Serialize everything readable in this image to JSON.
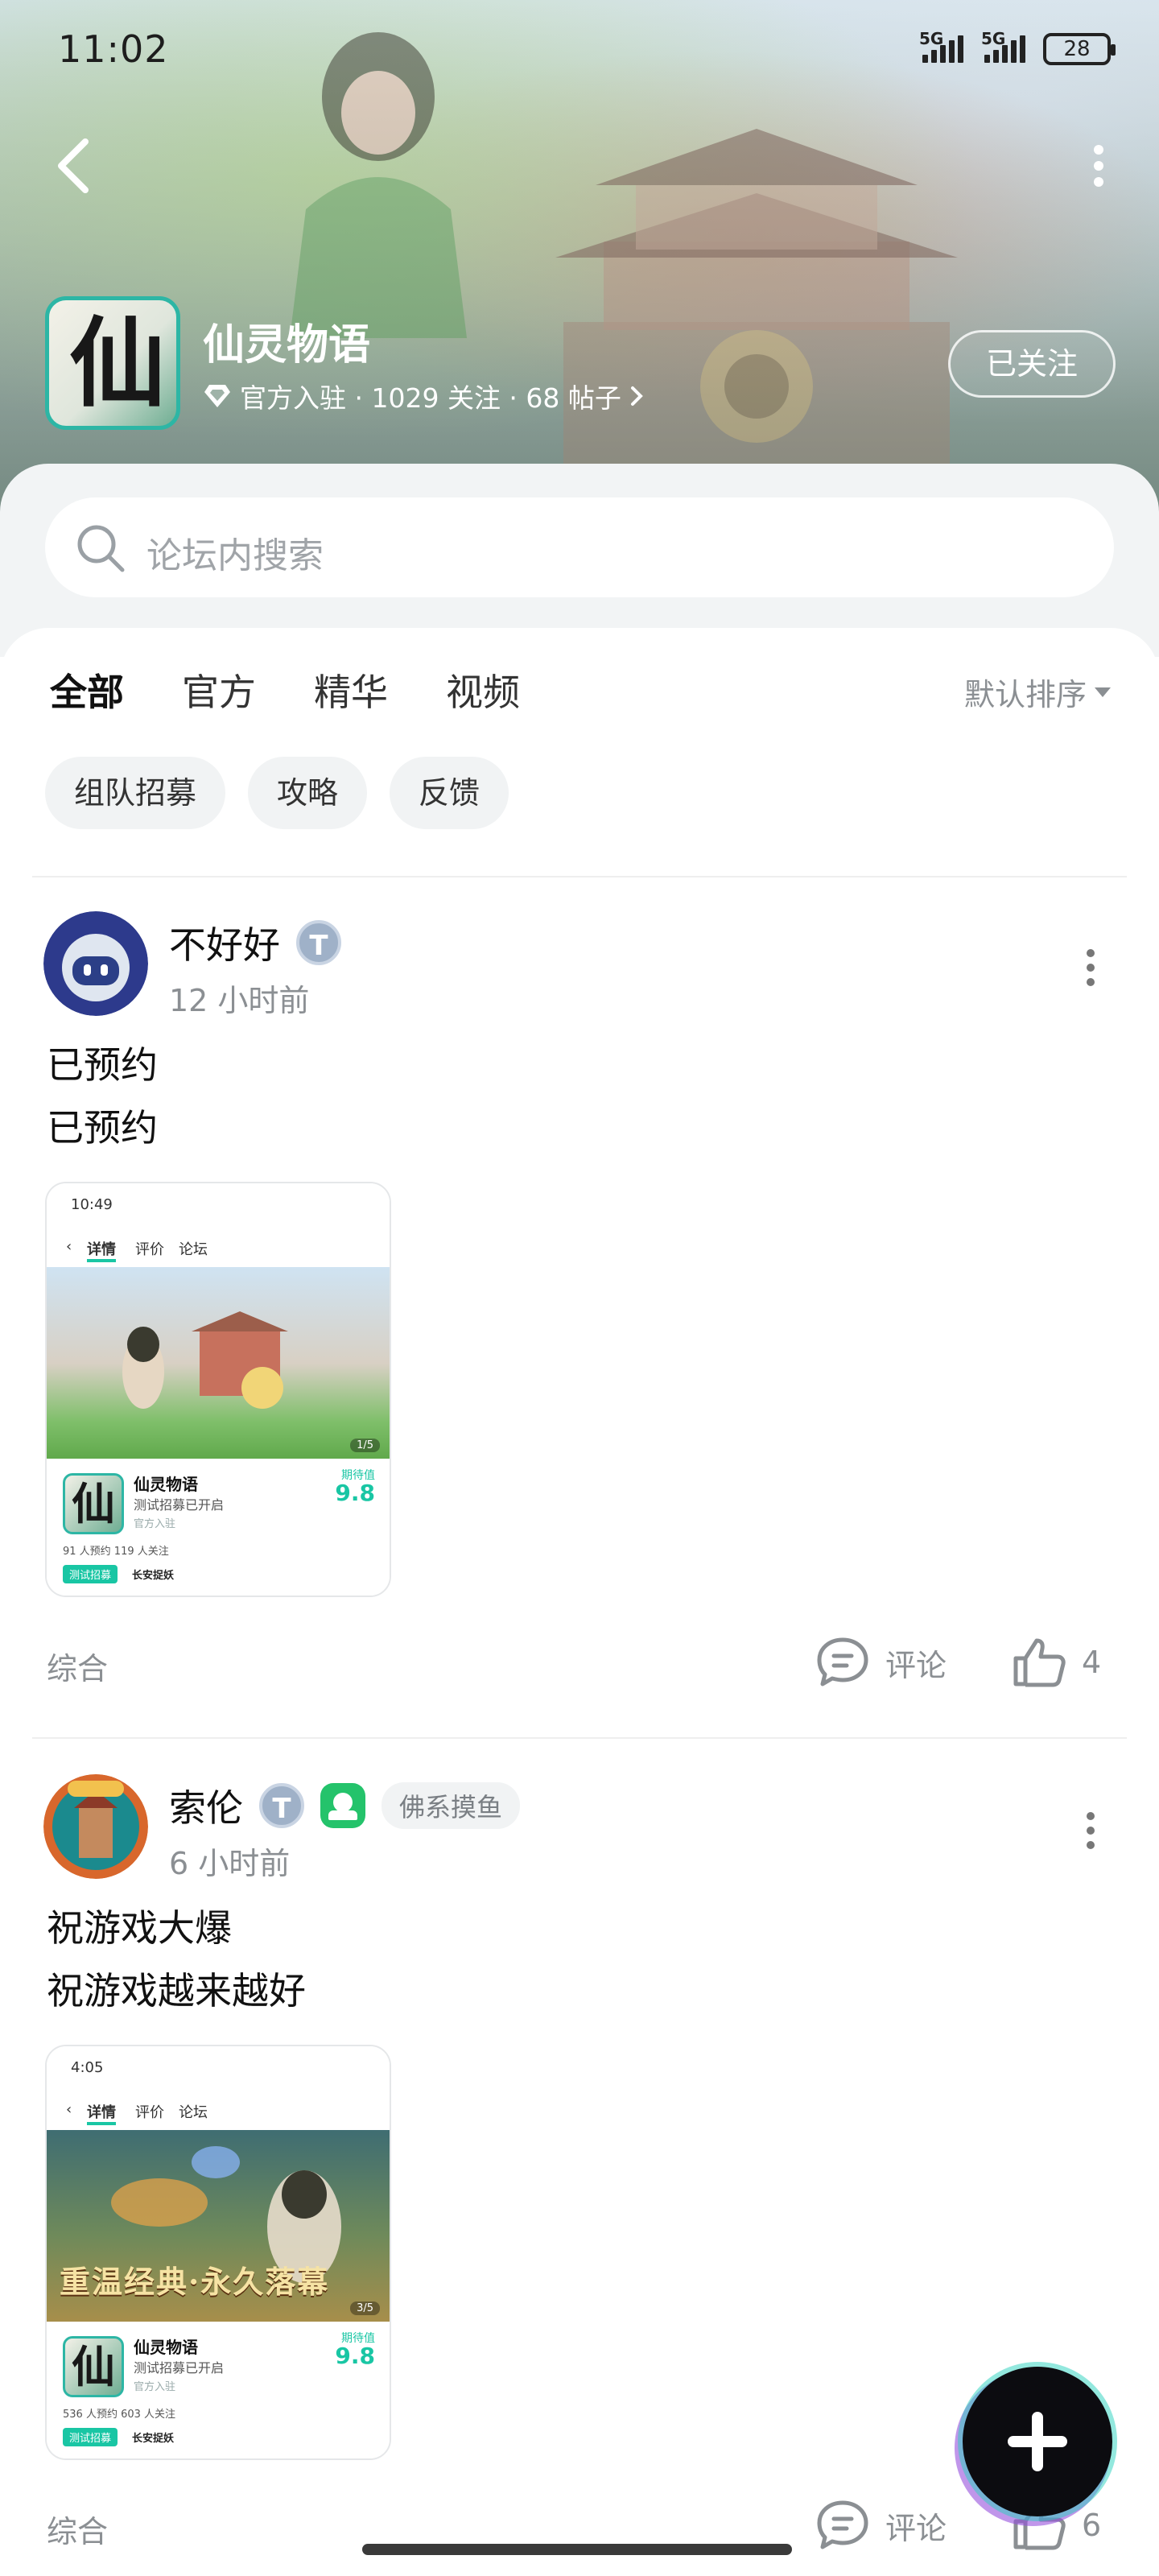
{
  "status_bar": {
    "time": "11:02",
    "network1": "5G",
    "network2": "5G",
    "battery": "28"
  },
  "forum": {
    "icon_glyph": "仙",
    "title": "仙灵物语",
    "meta": "官方入驻 · 1029 关注 · 68 帖子",
    "follow_label": "已关注"
  },
  "search": {
    "placeholder": "论坛内搜索"
  },
  "tabs": [
    {
      "label": "全部",
      "active": true
    },
    {
      "label": "官方"
    },
    {
      "label": "精华"
    },
    {
      "label": "视频"
    }
  ],
  "sort_label": "默认排序",
  "chips": [
    "组队招募",
    "攻略",
    "反馈"
  ],
  "posts": [
    {
      "author": "不好好",
      "badge": "T",
      "time": "12 小时前",
      "lines": [
        "已预约",
        "已预约"
      ],
      "category": "综合",
      "comment_label": "评论",
      "likes": "4",
      "image": {
        "status_time": "10:49",
        "tabs": [
          "详情",
          "评价",
          "论坛"
        ],
        "page": "1/5",
        "app_name": "仙灵物语",
        "app_sub": "测试招募已开启",
        "official": "官方入驻",
        "score_label": "期待值",
        "score": "9.8",
        "stats": "91 人预约   119 人关注",
        "tag": "测试招募",
        "tag2": "长安捉妖"
      }
    },
    {
      "author": "索伦",
      "badge": "T",
      "tag": "佛系摸鱼",
      "time": "6 小时前",
      "lines": [
        "祝游戏大爆",
        "祝游戏越来越好"
      ],
      "category": "综合",
      "comment_label": "评论",
      "likes": "6",
      "image": {
        "status_time": "4:05",
        "tabs": [
          "详情",
          "评价",
          "论坛"
        ],
        "page": "3/5",
        "app_name": "仙灵物语",
        "app_sub": "测试招募已开启",
        "official": "官方入驻",
        "score_label": "期待值",
        "score": "9.8",
        "stats": "536 人预约   603 人关注",
        "tag": "测试招募",
        "tag2": "长安捉妖",
        "banner_text": "重温经典·永久落幕"
      }
    }
  ],
  "colors": {
    "accent": "#19c6a4",
    "muted": "#8b8f93"
  }
}
